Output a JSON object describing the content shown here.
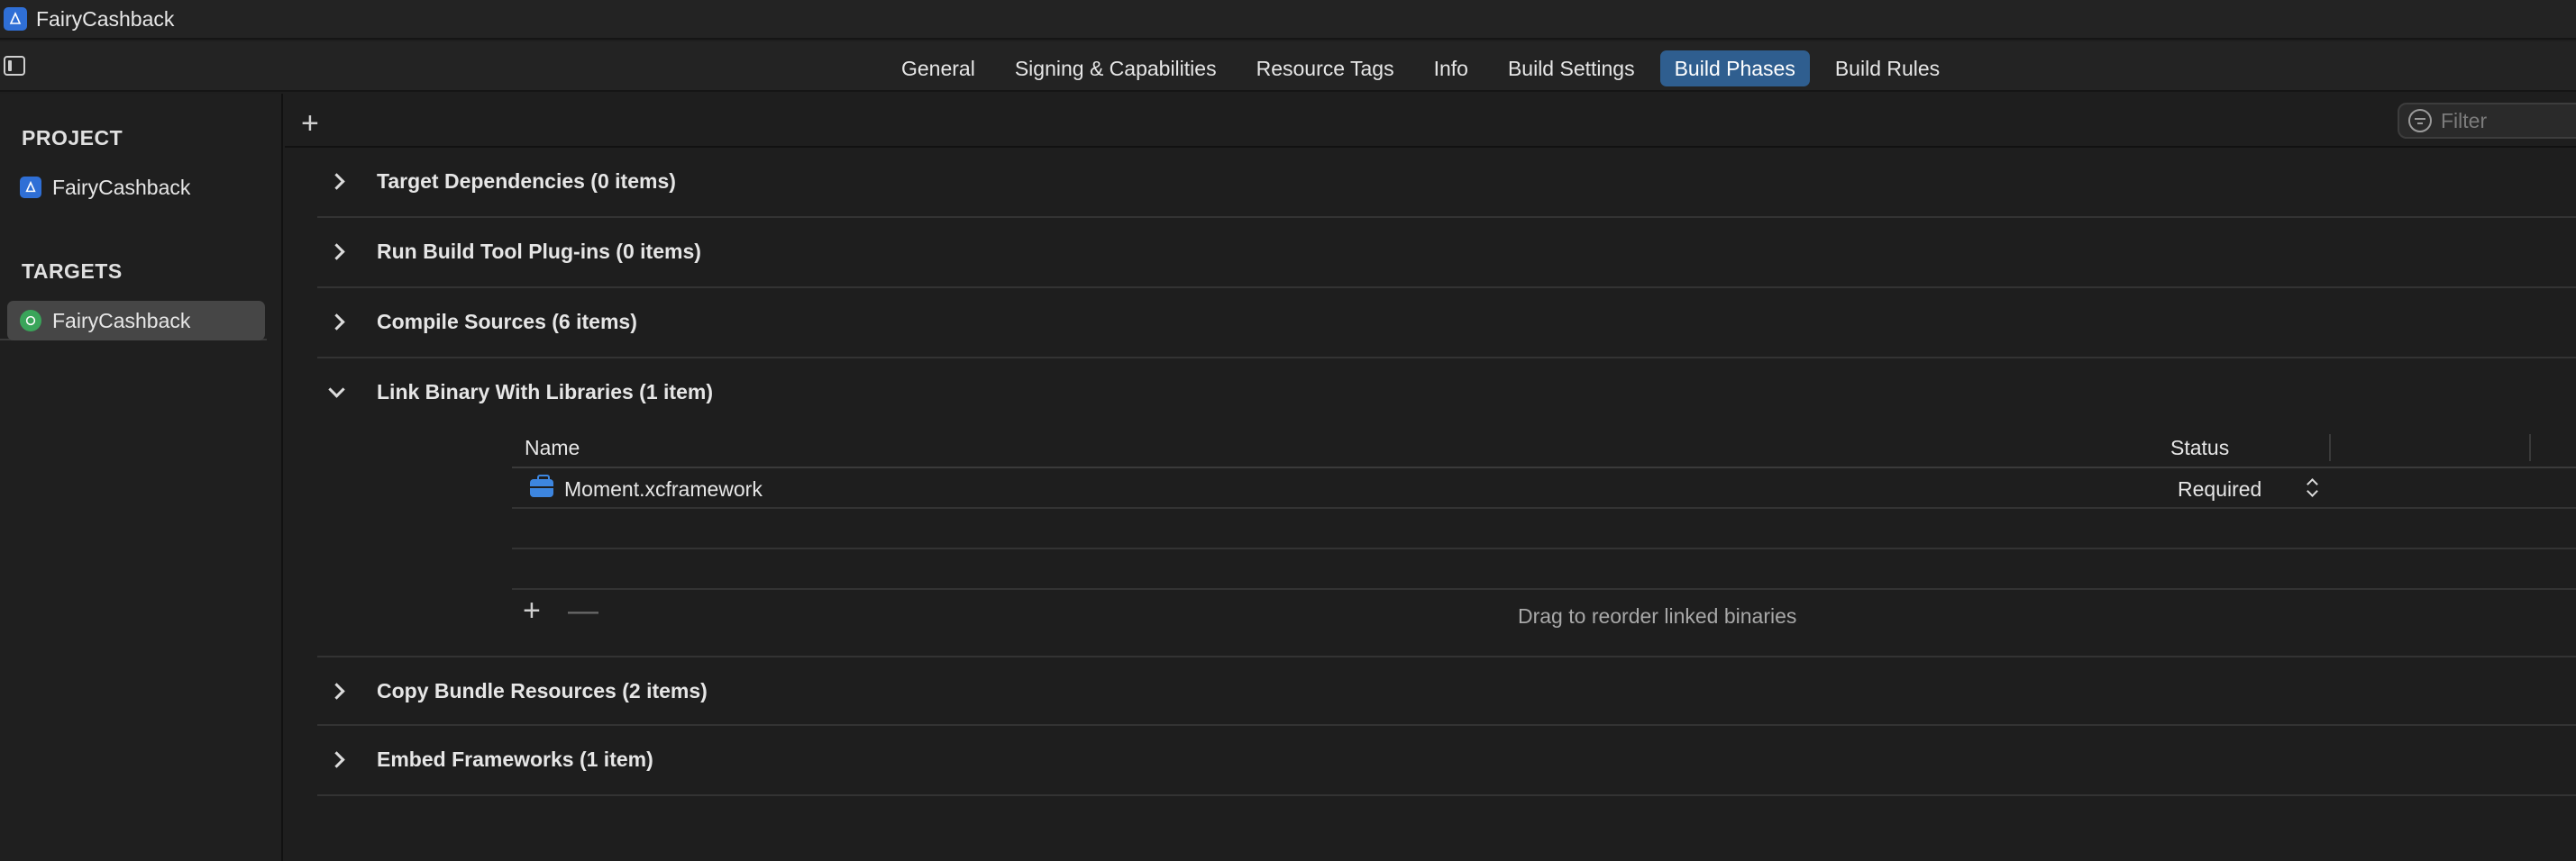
{
  "window": {
    "title": "FairyCashback"
  },
  "tabs": [
    {
      "label": "General",
      "active": false
    },
    {
      "label": "Signing & Capabilities",
      "active": false
    },
    {
      "label": "Resource Tags",
      "active": false
    },
    {
      "label": "Info",
      "active": false
    },
    {
      "label": "Build Settings",
      "active": false
    },
    {
      "label": "Build Phases",
      "active": true
    },
    {
      "label": "Build Rules",
      "active": false
    }
  ],
  "sidebar": {
    "project_header": "PROJECT",
    "project_item": "FairyCashback",
    "targets_header": "TARGETS",
    "target_item": "FairyCashback"
  },
  "filter": {
    "placeholder": "Filter",
    "value": ""
  },
  "phases": [
    {
      "title": "Target Dependencies (0 items)",
      "expanded": false
    },
    {
      "title": "Run Build Tool Plug-ins (0 items)",
      "expanded": false
    },
    {
      "title": "Compile Sources (6 items)",
      "expanded": false
    },
    {
      "title": "Link Binary With Libraries (1 item)",
      "expanded": true
    },
    {
      "title": "Copy Bundle Resources (2 items)",
      "expanded": false
    },
    {
      "title": "Embed Frameworks (1 item)",
      "expanded": false
    }
  ],
  "link_table": {
    "col_name": "Name",
    "col_status": "Status",
    "rows": [
      {
        "name": "Moment.xcframework",
        "status": "Required"
      }
    ],
    "plus": "+",
    "minus": "—",
    "hint": "Drag to reorder linked binaries"
  },
  "toolbar": {
    "add": "+"
  },
  "colors": {
    "accent": "#2f5e8f",
    "background": "#1e1e1e",
    "selected_row": "#464646"
  }
}
